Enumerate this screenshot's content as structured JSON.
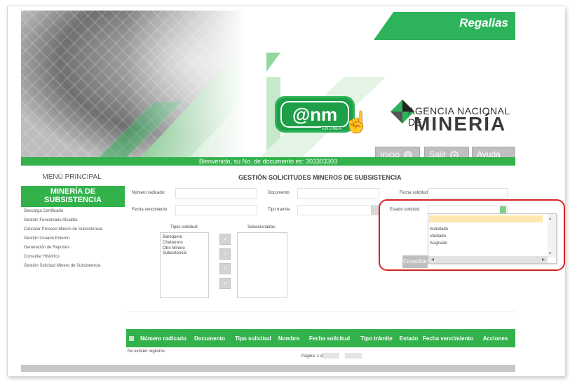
{
  "banner": {
    "regalias": "Regalias",
    "anm_logo": "@nm",
    "anm_sub": "EN LINEA",
    "agency_line1": "AGENCIA NACIONAL DE",
    "agency_line2": "MINERÍA",
    "nav": [
      {
        "label": "Inicio",
        "icon": "home-icon",
        "glyph": "⌂"
      },
      {
        "label": "Salir",
        "icon": "exit-icon",
        "glyph": "⏻"
      },
      {
        "label": "Ayuda",
        "icon": "help-icon",
        "glyph": "?"
      }
    ]
  },
  "welcome": "Bienvenido, su No. de documento es: 303303303",
  "menu": {
    "title": "MENÚ PRINCIPAL",
    "section": "MINERÍA DE SUBSISTENCIA",
    "items": [
      "Descarga Certificado",
      "Gestión Funcionario Alcaldía",
      "Cancelar Proceso Minero de Subsistencia",
      "Gestión Usuario Externo",
      "Generación de Reportes",
      "Consultar Histórico",
      "Gestión Solicitud Minero de Subsistencia"
    ]
  },
  "form": {
    "title": "GESTIÓN SOLICITUDES MINEROS DE SUBSISTENCIA",
    "numero_radicado": "Número radicado:",
    "documento": "Documento",
    "fecha_solicitud": "Fecha solicitud:",
    "fecha_vencimiento": "Fecha vencimiento",
    "tipo_tramite": "Tipo tramite",
    "estado_solicitud": "Estado solicitud:",
    "tipos_solicitud_label": "Tipos solicitud:",
    "seleccionados_label": "Seleccionados:",
    "tipos_solicitud": [
      "Barequero",
      "Chatarrero",
      "Otro Minero Subsistencia"
    ],
    "estado_options": [
      "",
      "Solicitado",
      "Validado",
      "Asignado"
    ],
    "consultar": "Consultar"
  },
  "table": {
    "headers": [
      "Número radicado",
      "Documento",
      "Tipo solicitud",
      "Nombre",
      "Fecha solicitud",
      "Tipo trámite",
      "Estado",
      "Fecha vencimiento",
      "Acciones"
    ],
    "empty": "No existen registros",
    "pager": "Página: 1 de 1"
  },
  "colors": {
    "brand_green": "#33b24c",
    "highlight": "#d42424"
  }
}
